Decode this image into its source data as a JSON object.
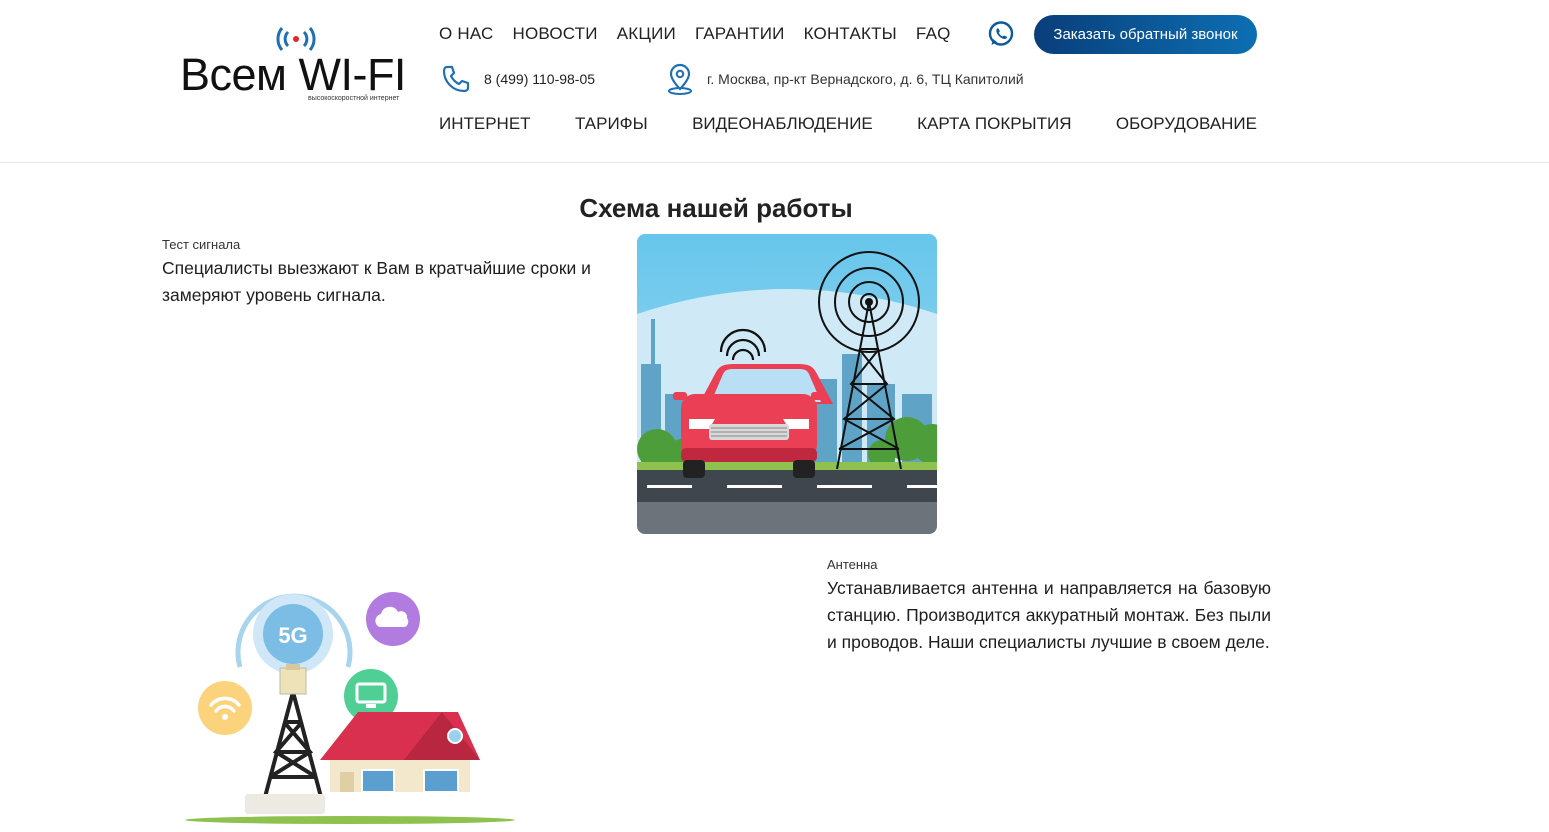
{
  "header": {
    "logo": {
      "text": "Всем WI-FI",
      "tagline": "высокоскоростной интернет"
    },
    "top_nav": [
      "О НАС",
      "НОВОСТИ",
      "АКЦИИ",
      "ГАРАНТИИ",
      "КОНТАКТЫ",
      "FAQ"
    ],
    "cta_label": "Заказать обратный звонок",
    "phone": "8 (499) 110-98-05",
    "address": "г. Москва, пр-кт Вернадского, д. 6, ТЦ Капитолий",
    "main_nav": [
      "ИНТЕРНЕТ",
      "ТАРИФЫ",
      "ВИДЕОНАБЛЮДЕНИЕ",
      "КАРТА ПОКРЫТИЯ",
      "ОБОРУДОВАНИЕ"
    ],
    "icons": {
      "whatsapp": "whatsapp-icon",
      "phone": "phone-icon",
      "location": "location-pin-icon"
    }
  },
  "section": {
    "title": "Схема нашей работы",
    "steps": [
      {
        "label": "Тест сигнала",
        "text": "Специалисты выезжают к Вам в кратчайшие сроки и замеряют уровень сигнала."
      },
      {
        "label": "Антенна",
        "text": "Устанавливается антенна и направляется на базовую станцию. Производится аккуратный монтаж. Без пыли и проводов. Наши специалисты лучшие в своем деле."
      }
    ],
    "illustration_labels": {
      "badge_5g": "5G",
      "badge_cloud": "CLOUD"
    }
  },
  "colors": {
    "brand_blue": "#0a4e8e",
    "cta_gradient_start": "#0a3e7a",
    "cta_gradient_end": "#0c6fb3",
    "icon_blue": "#1f6fb2"
  }
}
